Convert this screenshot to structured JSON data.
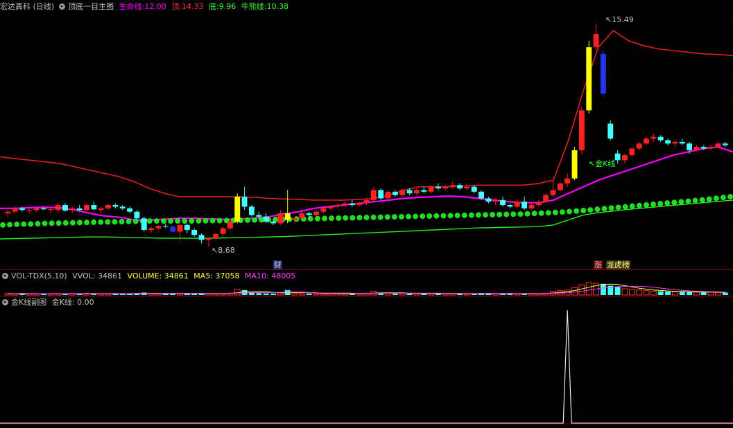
{
  "main_panel": {
    "stock_name": "宏达高科 (日线)",
    "indicator_name": "顶底一目主图",
    "life_line_label": "生命线:",
    "life_line_value": "12.00",
    "top_label": "顶:",
    "top_value": "14.33",
    "bottom_label": "底:",
    "bottom_value": "9.96",
    "bull_bear_label": "牛熊线:",
    "bull_bear_value": "10.38",
    "high_marker": "15.49",
    "low_marker": "8.68",
    "golden_k_marker": "金K线",
    "finance_tag": "财",
    "limit_tag_1": "涨",
    "limit_tag_2": "龙虎榜"
  },
  "vol_panel": {
    "name": "VOL-TDX(5,10)",
    "vvol": "VVOL: 34861",
    "volume": "VOLUME: 34861",
    "ma5": "MA5: 37058",
    "ma10": "MA10: 48005"
  },
  "sub_panel": {
    "name": "金K线副图",
    "value": "金K线: 0.00"
  },
  "colors": {
    "up": "#ff2020",
    "down": "#44ffff",
    "top_line": "#e02020",
    "life_line": "#ff00ff",
    "bottom_line": "#22ee22",
    "dots": "#22dd22",
    "yellow": "#ffff00",
    "blue": "#2233ee"
  },
  "chart_data": {
    "type": "candlestick",
    "price_range": [
      8.3,
      15.7
    ],
    "high": 15.49,
    "low": 8.68,
    "golden_k_signal_index": 76,
    "candles": [
      [
        9.8,
        9.9,
        9.7,
        9.85
      ],
      [
        9.85,
        10.0,
        9.8,
        9.95
      ],
      [
        9.95,
        10.0,
        9.85,
        9.9
      ],
      [
        9.9,
        9.95,
        9.8,
        9.9
      ],
      [
        9.9,
        10.0,
        9.85,
        9.95
      ],
      [
        9.95,
        10.0,
        9.9,
        9.92
      ],
      [
        9.9,
        9.95,
        9.8,
        9.92
      ],
      [
        9.9,
        10.1,
        9.8,
        10.05
      ],
      [
        10.05,
        10.1,
        9.85,
        9.88
      ],
      [
        9.9,
        10.0,
        9.8,
        9.95
      ],
      [
        9.95,
        10.05,
        9.85,
        9.9
      ],
      [
        9.9,
        10.1,
        9.85,
        10.05
      ],
      [
        10.05,
        10.15,
        9.9,
        9.92
      ],
      [
        9.9,
        10.0,
        9.8,
        9.95
      ],
      [
        9.95,
        10.1,
        9.9,
        10.05
      ],
      [
        10.05,
        10.1,
        9.95,
        10.0
      ],
      [
        10.0,
        10.05,
        9.9,
        9.95
      ],
      [
        9.95,
        10.0,
        9.8,
        9.85
      ],
      [
        9.85,
        9.9,
        9.6,
        9.65
      ],
      [
        9.65,
        9.7,
        9.25,
        9.3
      ],
      [
        9.3,
        9.4,
        9.2,
        9.35
      ],
      [
        9.35,
        9.45,
        9.3,
        9.42
      ],
      [
        9.42,
        9.5,
        9.35,
        9.4
      ],
      [
        9.4,
        9.45,
        9.2,
        9.25
      ],
      [
        9.25,
        9.5,
        9.0,
        9.45
      ],
      [
        9.45,
        9.5,
        9.2,
        9.3
      ],
      [
        9.3,
        9.35,
        9.1,
        9.15
      ],
      [
        9.15,
        9.2,
        8.9,
        9.0
      ],
      [
        9.0,
        9.1,
        8.8,
        9.05
      ],
      [
        9.05,
        9.2,
        9.0,
        9.18
      ],
      [
        9.18,
        9.4,
        9.1,
        9.35
      ],
      [
        9.35,
        9.6,
        9.3,
        9.55
      ],
      [
        9.55,
        10.4,
        9.5,
        10.3
      ],
      [
        10.3,
        10.6,
        9.9,
        10.0
      ],
      [
        10.0,
        10.05,
        9.7,
        9.75
      ],
      [
        9.75,
        9.85,
        9.6,
        9.7
      ],
      [
        9.7,
        9.8,
        9.5,
        9.55
      ],
      [
        9.55,
        9.6,
        9.45,
        9.5
      ],
      [
        9.5,
        9.9,
        9.45,
        9.8
      ],
      [
        9.8,
        10.5,
        9.5,
        9.6
      ],
      [
        9.6,
        9.7,
        9.5,
        9.65
      ],
      [
        9.65,
        9.85,
        9.6,
        9.8
      ],
      [
        9.8,
        9.85,
        9.65,
        9.75
      ],
      [
        9.75,
        9.9,
        9.7,
        9.85
      ],
      [
        9.85,
        10.0,
        9.8,
        9.95
      ],
      [
        9.95,
        10.05,
        9.9,
        10.02
      ],
      [
        10.02,
        10.1,
        9.95,
        10.05
      ],
      [
        10.05,
        10.15,
        10.0,
        10.1
      ],
      [
        10.1,
        10.2,
        10.0,
        10.05
      ],
      [
        10.05,
        10.15,
        10.0,
        10.12
      ],
      [
        10.12,
        10.25,
        10.05,
        10.2
      ],
      [
        10.2,
        10.6,
        10.15,
        10.5
      ],
      [
        10.5,
        10.55,
        10.2,
        10.25
      ],
      [
        10.25,
        10.5,
        10.2,
        10.45
      ],
      [
        10.45,
        10.5,
        10.3,
        10.35
      ],
      [
        10.35,
        10.55,
        10.3,
        10.5
      ],
      [
        10.5,
        10.55,
        10.35,
        10.4
      ],
      [
        10.4,
        10.55,
        10.35,
        10.5
      ],
      [
        10.5,
        10.6,
        10.4,
        10.45
      ],
      [
        10.45,
        10.65,
        10.4,
        10.6
      ],
      [
        10.6,
        10.7,
        10.5,
        10.55
      ],
      [
        10.55,
        10.65,
        10.5,
        10.6
      ],
      [
        10.6,
        10.75,
        10.55,
        10.65
      ],
      [
        10.65,
        10.7,
        10.5,
        10.55
      ],
      [
        10.55,
        10.7,
        10.5,
        10.6
      ],
      [
        10.6,
        10.65,
        10.4,
        10.45
      ],
      [
        10.45,
        10.5,
        10.2,
        10.25
      ],
      [
        10.25,
        10.3,
        10.1,
        10.15
      ],
      [
        10.15,
        10.25,
        10.05,
        10.2
      ],
      [
        10.2,
        10.3,
        10.0,
        10.05
      ],
      [
        10.05,
        10.1,
        9.95,
        10.0
      ],
      [
        10.0,
        10.2,
        9.95,
        10.15
      ],
      [
        10.15,
        10.3,
        9.9,
        9.95
      ],
      [
        9.95,
        10.1,
        9.9,
        10.05
      ],
      [
        10.05,
        10.2,
        10.0,
        10.15
      ],
      [
        10.15,
        10.4,
        10.1,
        10.35
      ],
      [
        10.35,
        10.8,
        10.3,
        10.5
      ],
      [
        10.5,
        10.75,
        10.45,
        10.7
      ],
      [
        10.7,
        11.0,
        10.6,
        10.85
      ],
      [
        10.85,
        11.8,
        10.8,
        11.7
      ],
      [
        11.7,
        13.0,
        11.6,
        12.9
      ],
      [
        12.9,
        15.0,
        12.8,
        14.8
      ],
      [
        14.8,
        15.49,
        14.7,
        15.2
      ],
      [
        14.6,
        14.7,
        13.3,
        13.4
      ],
      [
        12.5,
        12.6,
        12.0,
        12.05
      ],
      [
        11.6,
        11.7,
        11.3,
        11.4
      ],
      [
        11.4,
        11.6,
        11.3,
        11.55
      ],
      [
        11.55,
        11.8,
        11.5,
        11.75
      ],
      [
        11.75,
        11.95,
        11.7,
        11.9
      ],
      [
        11.9,
        12.1,
        11.85,
        12.05
      ],
      [
        12.05,
        12.2,
        11.95,
        12.1
      ],
      [
        12.1,
        12.15,
        11.95,
        12.0
      ],
      [
        12.0,
        12.05,
        11.85,
        11.9
      ],
      [
        11.9,
        12.0,
        11.8,
        11.95
      ],
      [
        11.95,
        12.05,
        11.85,
        11.9
      ],
      [
        11.9,
        11.95,
        11.6,
        11.7
      ],
      [
        11.7,
        11.85,
        11.65,
        11.8
      ],
      [
        11.8,
        11.85,
        11.7,
        11.75
      ],
      [
        11.75,
        11.85,
        11.7,
        11.8
      ],
      [
        11.8,
        11.95,
        11.75,
        11.9
      ],
      [
        11.9,
        11.95,
        11.8,
        11.85
      ]
    ],
    "top_line": [
      11.5,
      11.45,
      11.4,
      11.35,
      11.3,
      11.2,
      11.1,
      11.0,
      10.9,
      10.75,
      10.55,
      10.4,
      10.3,
      10.3,
      10.3,
      10.3,
      10.3,
      10.28,
      10.25,
      10.23,
      10.22,
      10.2,
      10.2,
      10.2,
      10.22,
      10.25,
      10.35,
      10.5,
      10.6,
      10.6,
      10.6,
      10.62,
      10.65,
      10.65,
      10.65,
      10.65,
      10.7,
      10.8,
      12.0,
      13.5,
      14.8,
      15.3,
      15.0,
      14.85,
      14.75,
      14.7,
      14.65,
      14.6,
      14.58,
      14.55
    ],
    "life_line": [
      9.95,
      9.95,
      9.97,
      9.98,
      9.97,
      9.9,
      9.8,
      9.72,
      9.68,
      9.6,
      9.6,
      9.62,
      9.65,
      9.65,
      9.63,
      9.62,
      9.63,
      9.65,
      9.7,
      9.78,
      9.85,
      9.95,
      10.0,
      10.05,
      10.1,
      10.15,
      10.2,
      10.25,
      10.28,
      10.3,
      10.32,
      10.3,
      10.25,
      10.2,
      10.15,
      10.12,
      10.12,
      10.2,
      10.4,
      10.6,
      10.8,
      10.95,
      11.1,
      11.25,
      11.4,
      11.55,
      11.65,
      11.75,
      11.8,
      11.65
    ],
    "dots_line": [
      9.45,
      9.47,
      9.48,
      9.5,
      9.51,
      9.52,
      9.53,
      9.54,
      9.55,
      9.56,
      9.57,
      9.57,
      9.57,
      9.57,
      9.58,
      9.58,
      9.59,
      9.6,
      9.61,
      9.62,
      9.63,
      9.64,
      9.65,
      9.66,
      9.67,
      9.68,
      9.69,
      9.7,
      9.71,
      9.72,
      9.73,
      9.74,
      9.75,
      9.76,
      9.77,
      9.78,
      9.8,
      9.82,
      9.85,
      9.88,
      9.92,
      9.96,
      10.0,
      10.04,
      10.08,
      10.12,
      10.16,
      10.2,
      10.25,
      10.3
    ],
    "bottom_line": [
      9.03,
      9.04,
      9.05,
      9.06,
      9.07,
      9.08,
      9.09,
      9.09,
      9.08,
      9.07,
      9.06,
      9.05,
      9.05,
      9.05,
      9.05,
      9.06,
      9.07,
      9.08,
      9.09,
      9.1,
      9.12,
      9.14,
      9.16,
      9.18,
      9.2,
      9.22,
      9.24,
      9.26,
      9.28,
      9.3,
      9.32,
      9.34,
      9.36,
      9.37,
      9.38,
      9.39,
      9.4,
      9.45,
      9.6,
      9.75,
      9.82,
      9.87,
      9.92,
      9.96,
      10.0,
      10.04,
      10.08,
      10.12,
      10.16,
      10.2
    ],
    "volume": [
      0.12,
      0.1,
      0.14,
      0.11,
      0.09,
      0.12,
      0.1,
      0.13,
      0.11,
      0.12,
      0.1,
      0.14,
      0.12,
      0.1,
      0.11,
      0.12,
      0.1,
      0.13,
      0.15,
      0.2,
      0.12,
      0.1,
      0.11,
      0.13,
      0.15,
      0.12,
      0.1,
      0.14,
      0.12,
      0.1,
      0.13,
      0.15,
      0.45,
      0.4,
      0.22,
      0.15,
      0.13,
      0.12,
      0.2,
      0.4,
      0.15,
      0.12,
      0.13,
      0.11,
      0.12,
      0.13,
      0.12,
      0.11,
      0.1,
      0.12,
      0.15,
      0.3,
      0.2,
      0.15,
      0.12,
      0.14,
      0.12,
      0.13,
      0.12,
      0.14,
      0.12,
      0.1,
      0.13,
      0.12,
      0.1,
      0.11,
      0.15,
      0.12,
      0.1,
      0.13,
      0.12,
      0.1,
      0.14,
      0.12,
      0.1,
      0.15,
      0.3,
      0.35,
      0.4,
      0.6,
      0.8,
      1.0,
      0.95,
      0.9,
      0.75,
      0.65,
      0.5,
      0.45,
      0.4,
      0.35,
      0.32,
      0.3,
      0.28,
      0.26,
      0.25,
      0.24,
      0.23,
      0.22,
      0.22,
      0.21,
      0.2
    ],
    "golden_k_line": "single spike at signal index, value range 0-1"
  }
}
